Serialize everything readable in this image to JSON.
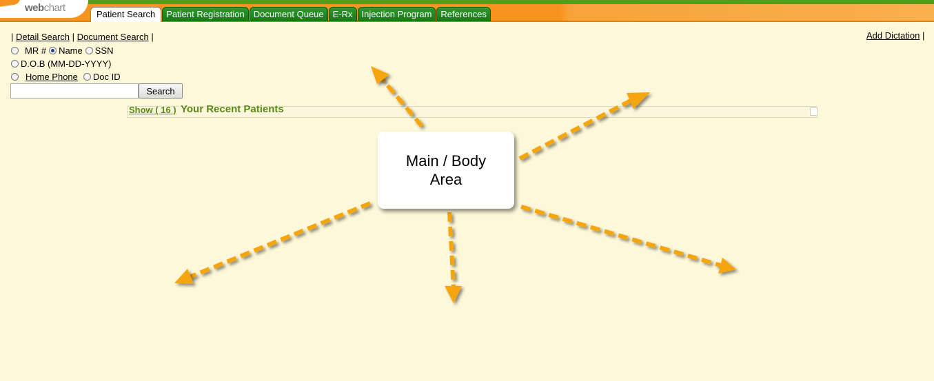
{
  "header": {
    "logo_bold": "web",
    "logo_light": "chart",
    "tabs": [
      {
        "label": "Patient Search",
        "active": true
      },
      {
        "label": "Patient Registration",
        "active": false
      },
      {
        "label": "Document Queue",
        "active": false
      },
      {
        "label": "E-Rx",
        "active": false
      },
      {
        "label": "Injection Program",
        "active": false
      },
      {
        "label": "References",
        "active": false
      }
    ]
  },
  "search": {
    "links": [
      "Detail Search",
      "Document Search"
    ],
    "options": {
      "mr": "MR #",
      "name": "Name",
      "ssn": "SSN",
      "dob": "D.O.B (MM-DD-YYYY)",
      "home_phone": "Home Phone",
      "doc_id": "Doc ID"
    },
    "selected": "name",
    "input_value": "",
    "button_label": "Search"
  },
  "dictation": {
    "label": "Add Dictation"
  },
  "recent": {
    "show_label": "Show ( 16 )",
    "title": "Your Recent Patients"
  },
  "annotation": {
    "line1": "Main / Body",
    "line2": "Area"
  },
  "colors": {
    "background": "#fdf8d9",
    "header_orange": "#f7941d",
    "tab_green": "#137a13",
    "accent_green": "#5a8a18",
    "arrow": "#f5a50f"
  }
}
